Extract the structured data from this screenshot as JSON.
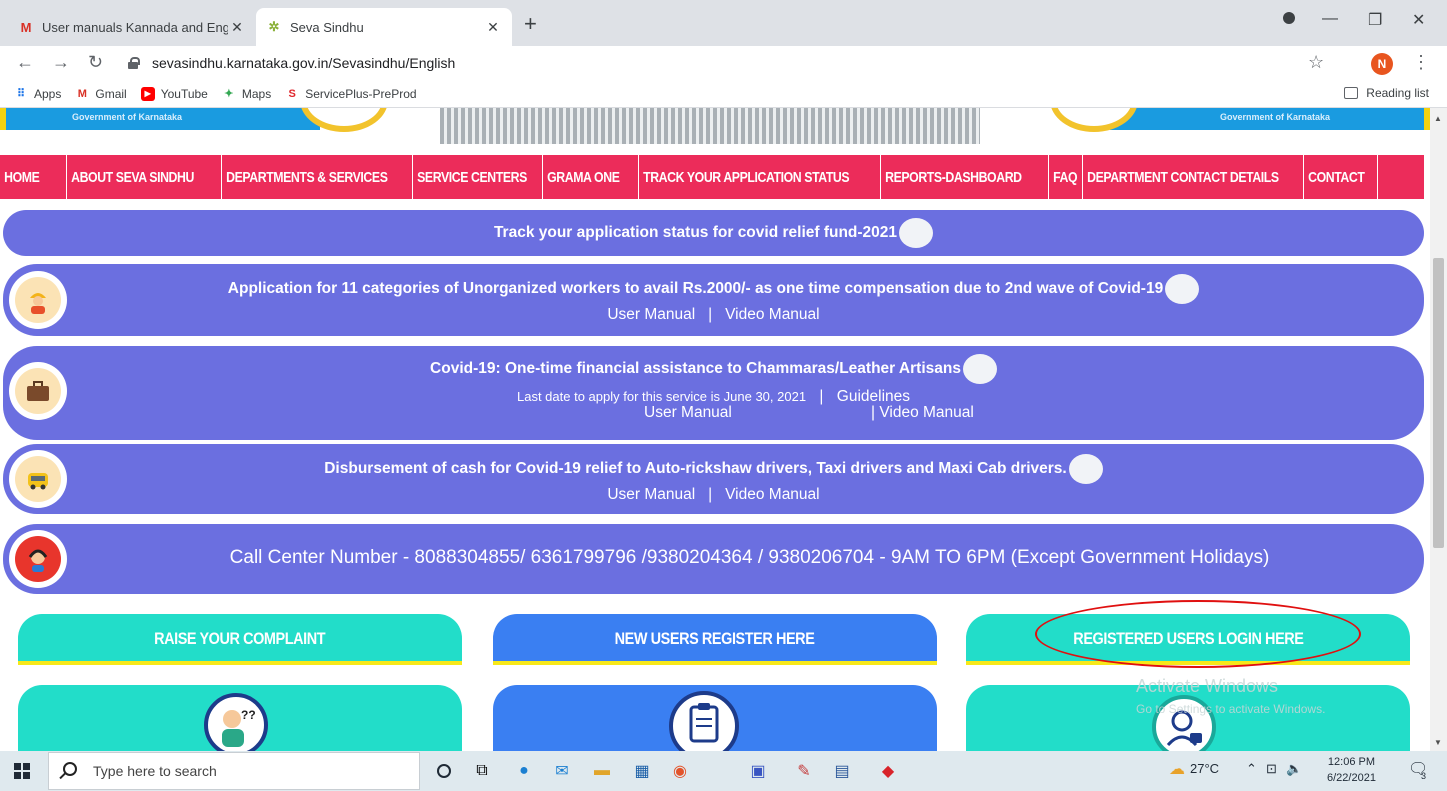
{
  "browser": {
    "tabs": [
      {
        "title": "User manuals Kannada and Engli",
        "active": false
      },
      {
        "title": "Seva Sindhu",
        "active": true
      }
    ],
    "new_tab": "+",
    "url": "sevasindhu.karnataka.gov.in/Sevasindhu/English",
    "profile_initial": "N",
    "bookmarks": [
      "Apps",
      "Gmail",
      "YouTube",
      "Maps",
      "ServicePlus-PreProd"
    ],
    "reading_list": "Reading list"
  },
  "banner": {
    "left_text": "Government of Karnataka",
    "right_text": "Government of Karnataka"
  },
  "menu": [
    "HOME",
    "ABOUT SEVA SINDHU",
    "DEPARTMENTS & SERVICES",
    "SERVICE CENTERS",
    "GRAMA ONE",
    "TRACK YOUR APPLICATION STATUS",
    "REPORTS-DASHBOARD",
    "FAQ",
    "DEPARTMENT CONTACT DETAILS",
    "CONTACT"
  ],
  "notices": {
    "covid_track": "Track your application status for covid relief fund-2021",
    "unorganized": {
      "title": "Application for 11 categories of Unorganized workers to avail Rs.2000/- as one time compensation due to 2nd wave of Covid-19",
      "user_manual": "User Manual",
      "sep": "|",
      "video_manual": "Video Manual"
    },
    "chammaras": {
      "title": "Covid-19: One-time financial assistance to Chammaras/Leather Artisans",
      "last_date": "Last date to apply for this service is June 30, 2021",
      "sep": "|",
      "guidelines": "Guidelines",
      "user_manual": "User Manual",
      "video_manual": "| Video Manual"
    },
    "auto": {
      "title": "Disbursement of cash for Covid-19 relief to Auto-rickshaw drivers, Taxi drivers and Maxi Cab drivers.",
      "user_manual": "User Manual",
      "sep": "|",
      "video_manual": "Video Manual"
    },
    "call_center": "Call Center Number - 8088304855/ 6361799796 /9380204364 / 9380206704 - 9AM TO 6PM (Except Government Holidays)"
  },
  "cards": {
    "complaint": "RAISE YOUR COMPLAINT",
    "register": "NEW USERS REGISTER HERE",
    "login": "REGISTERED USERS LOGIN HERE"
  },
  "watermark": {
    "title": "Activate Windows",
    "sub": "Go to Settings to activate Windows."
  },
  "taskbar": {
    "search_placeholder": "Type here to search",
    "weather": "27°C",
    "time": "12:06 PM",
    "date": "6/22/2021",
    "notifications": "3"
  },
  "colors": {
    "menu_bg": "#ec2c5a",
    "pill_bg": "#6b6fe0",
    "card_teal": "#22ddc9",
    "card_blue": "#3a7ff2",
    "underline_yellow": "#f7e81a",
    "highlight_red": "#e01010"
  },
  "icons": [
    "gmail-icon",
    "seva-sindhu-icon",
    "worker-icon",
    "briefcase-icon",
    "taxi-icon",
    "call-center-icon",
    "complaint-person-icon",
    "clipboard-icon",
    "user-lock-icon"
  ]
}
